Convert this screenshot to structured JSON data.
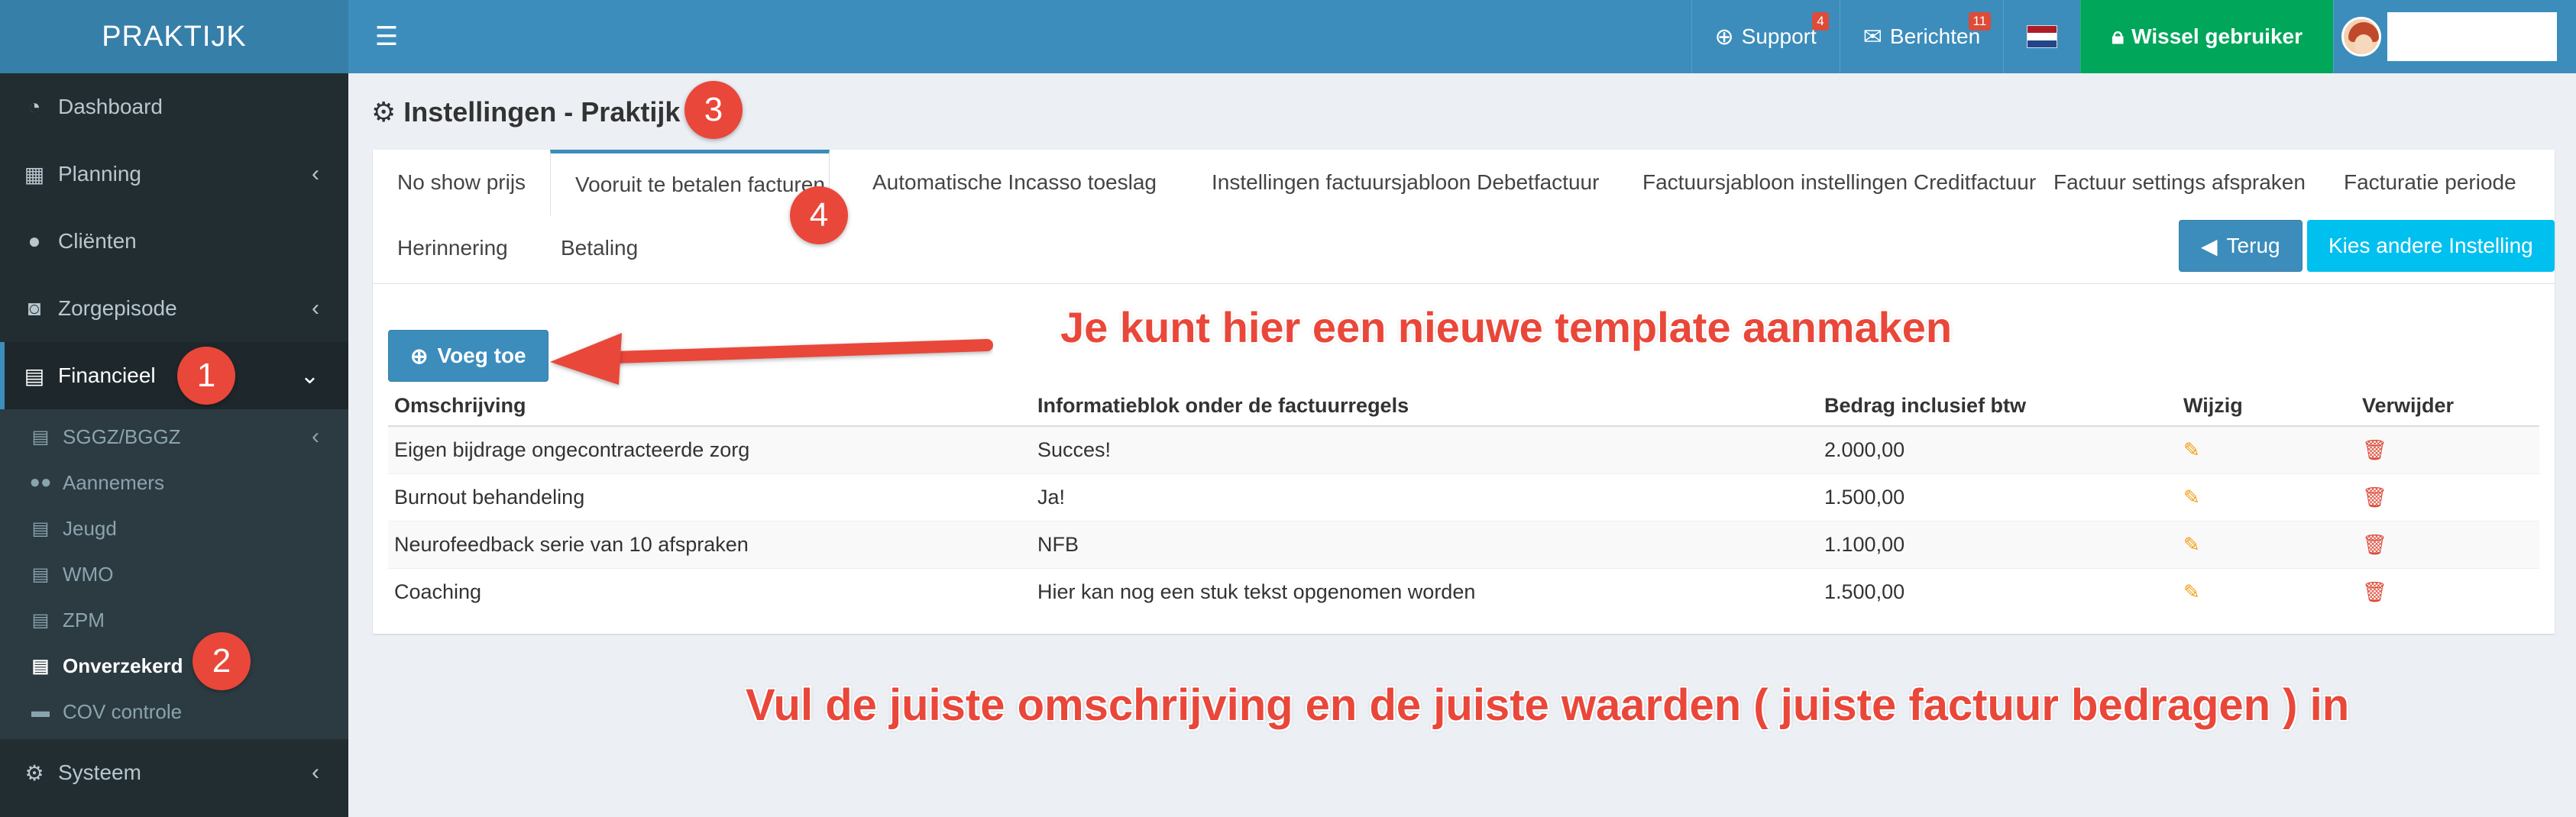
{
  "brand": "PRAKTIJK",
  "topnav": {
    "support_label": "Support",
    "support_badge": "4",
    "berichten_label": "Berichten",
    "berichten_badge": "11",
    "wissel_label": "Wissel gebruiker"
  },
  "sidebar": {
    "items": [
      {
        "label": "Dashboard",
        "icon": "dashboard-icon"
      },
      {
        "label": "Planning",
        "icon": "calendar-icon"
      },
      {
        "label": "Cliënten",
        "icon": "user-icon"
      },
      {
        "label": "Zorgepisode",
        "icon": "camera-icon"
      },
      {
        "label": "Financieel",
        "icon": "book-icon"
      },
      {
        "label": "Systeem",
        "icon": "gears-icon"
      }
    ],
    "sub": [
      {
        "label": "SGGZ/BGGZ"
      },
      {
        "label": "Aannemers"
      },
      {
        "label": "Jeugd"
      },
      {
        "label": "WMO"
      },
      {
        "label": "ZPM"
      },
      {
        "label": "Onverzekerd"
      },
      {
        "label": "COV controle"
      }
    ]
  },
  "page": {
    "title": "Instellingen - Praktijk"
  },
  "tabs": [
    "No show prijs",
    "Vooruit te betalen facturen",
    "Automatische Incasso toeslag",
    "Instellingen factuursjabloon Debetfactuur",
    "Factuursjabloon instellingen Creditfactuur",
    "Factuur settings afspraken",
    "Facturatie periode",
    "Herinnering",
    "Betaling"
  ],
  "buttons": {
    "terug": "Terug",
    "kies": "Kies andere Instelling",
    "voeg": "Voeg toe"
  },
  "table": {
    "headers": [
      "Omschrijving",
      "Informatieblok onder de factuurregels",
      "Bedrag inclusief btw",
      "Wijzig",
      "Verwijder"
    ],
    "rows": [
      [
        "Eigen bijdrage ongecontracteerde zorg",
        "Succes!",
        "2.000,00"
      ],
      [
        "Burnout behandeling",
        "Ja!",
        "1.500,00"
      ],
      [
        "Neurofeedback serie van 10 afspraken",
        "NFB",
        "1.100,00"
      ],
      [
        "Coaching",
        "Hier kan nog een stuk tekst opgenomen worden",
        "1.500,00"
      ]
    ]
  },
  "annotations": {
    "markers": [
      "1",
      "2",
      "3",
      "4"
    ],
    "text_top": "Je kunt hier een nieuwe template aanmaken",
    "text_bottom": "Vul de juiste omschrijving en de juiste waarden ( juiste factuur bedragen ) in"
  },
  "colors": {
    "accent": "#3c8dbc",
    "header_dark": "#367fa9",
    "sidebar": "#222d32",
    "success": "#00a65a",
    "info": "#00c0ef",
    "annotation": "#e9473a"
  }
}
